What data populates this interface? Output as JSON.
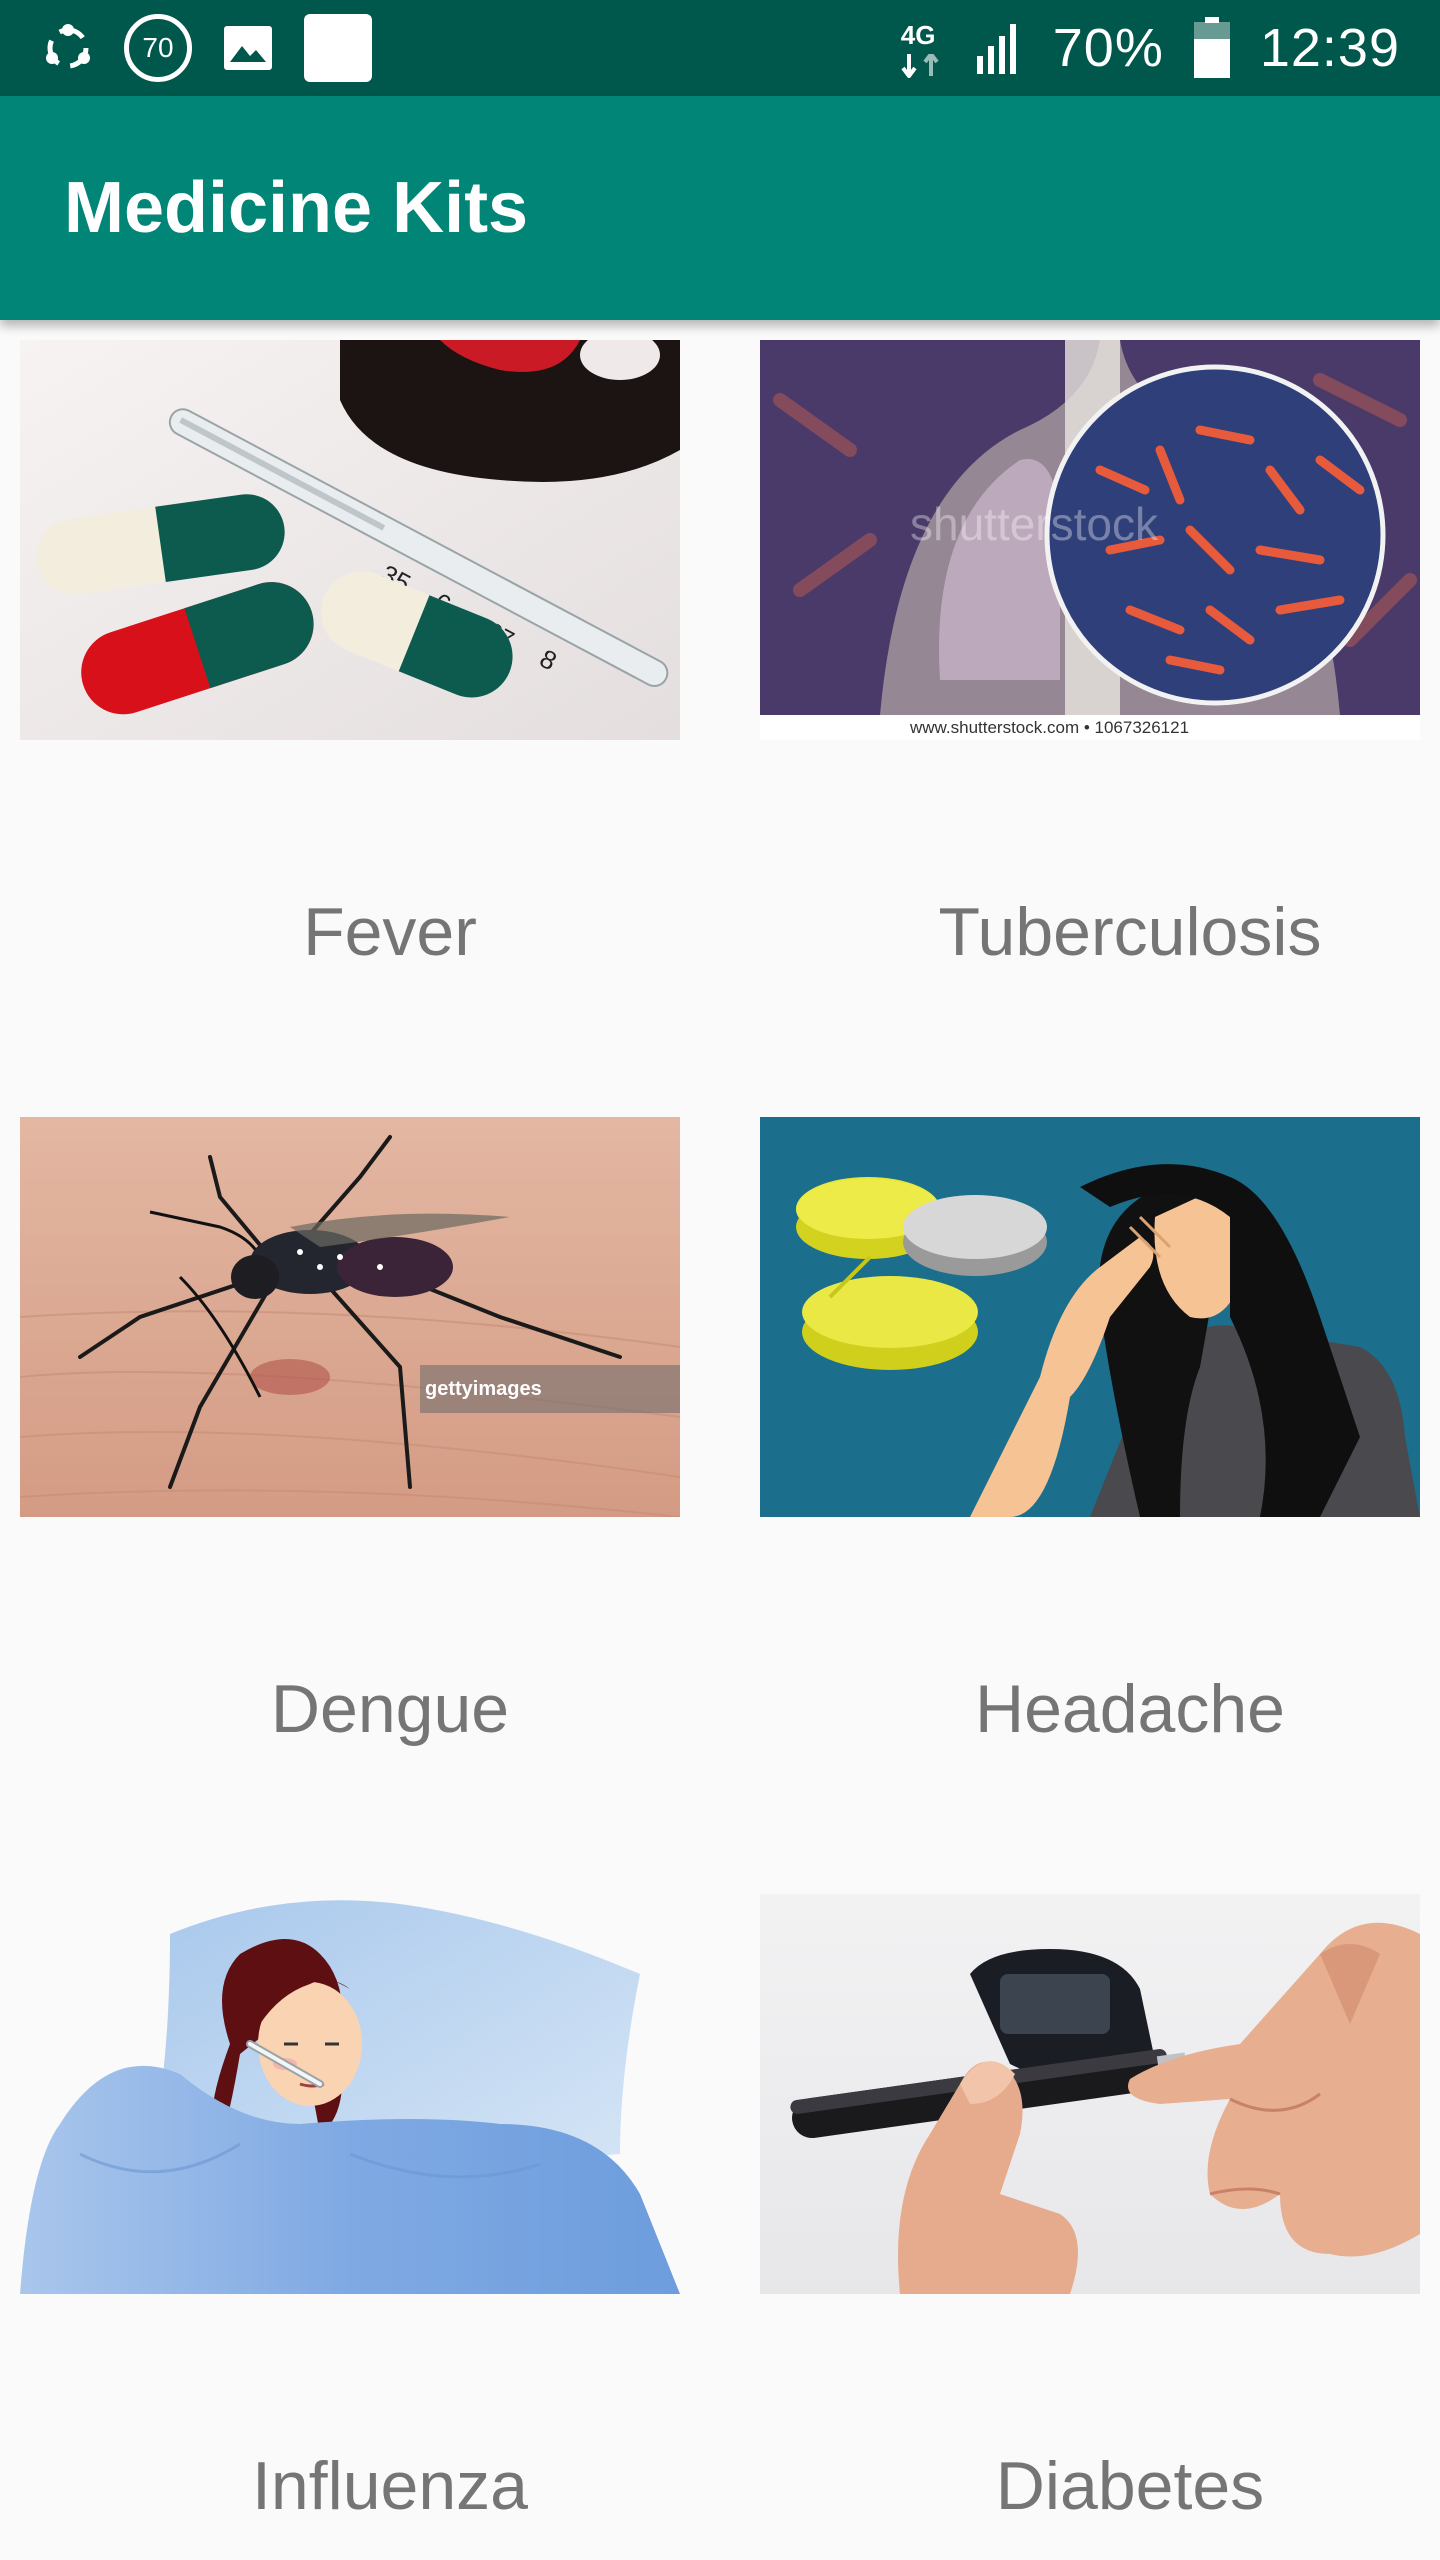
{
  "status_bar": {
    "network": "4G",
    "battery": "70%",
    "time": "12:39",
    "badge": "70",
    "icons": [
      "sync-icon",
      "badge-70-icon",
      "image-icon",
      "blank-notification-icon",
      "network-4g-icon",
      "signal-icon",
      "battery-icon"
    ]
  },
  "app_bar": {
    "title": "Medicine Kits"
  },
  "kits": [
    {
      "label": "Fever",
      "image": "pills-thermometer-image",
      "thermo_digits": [
        "35",
        "6",
        "37",
        "8"
      ]
    },
    {
      "label": "Tuberculosis",
      "image": "lungs-bacteria-image",
      "watermark": "www.shutterstock.com • 1067326121",
      "overlay_text": "shutterstock"
    },
    {
      "label": "Dengue",
      "image": "mosquito-image",
      "watermark": "gettyimages"
    },
    {
      "label": "Headache",
      "image": "woman-headache-pills-image"
    },
    {
      "label": "Influenza",
      "image": "sick-person-bed-image"
    },
    {
      "label": "Diabetes",
      "image": "glucose-meter-image"
    }
  ],
  "colors": {
    "status_bar": "#00574b",
    "app_bar": "#008577",
    "background": "#fafafa",
    "label_text": "#757575"
  }
}
